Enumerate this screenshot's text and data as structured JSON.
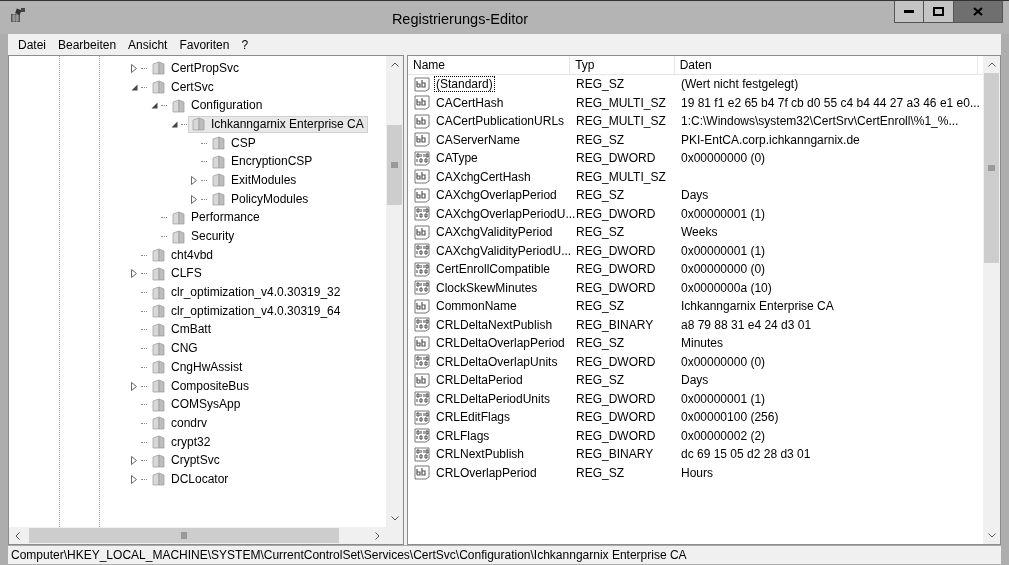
{
  "window": {
    "title": "Registrierungs-Editor"
  },
  "menu": [
    "Datei",
    "Bearbeiten",
    "Ansicht",
    "Favoriten",
    "?"
  ],
  "tree": [
    {
      "label": "CertPropSvc",
      "kind": "branch",
      "selected": false
    },
    {
      "label": "CertSvc",
      "kind": "branch",
      "selected": false,
      "children": [
        {
          "label": "Configuration",
          "kind": "branch",
          "selected": false,
          "children": [
            {
              "label": "Ichkanngarnix Enterprise CA",
              "kind": "branch",
              "selected": true,
              "children": [
                {
                  "label": "CSP",
                  "kind": "leaf",
                  "selected": false
                },
                {
                  "label": "EncryptionCSP",
                  "kind": "leaf",
                  "selected": false
                },
                {
                  "label": "ExitModules",
                  "kind": "branch",
                  "selected": false
                },
                {
                  "label": "PolicyModules",
                  "kind": "branch",
                  "selected": false
                }
              ]
            }
          ]
        },
        {
          "label": "Performance",
          "kind": "leaf",
          "selected": false
        },
        {
          "label": "Security",
          "kind": "leaf",
          "selected": false
        }
      ]
    },
    {
      "label": "cht4vbd",
      "kind": "leaf",
      "selected": false
    },
    {
      "label": "CLFS",
      "kind": "branch",
      "selected": false
    },
    {
      "label": "clr_optimization_v4.0.30319_32",
      "kind": "leaf",
      "selected": false
    },
    {
      "label": "clr_optimization_v4.0.30319_64",
      "kind": "leaf",
      "selected": false
    },
    {
      "label": "CmBatt",
      "kind": "leaf",
      "selected": false
    },
    {
      "label": "CNG",
      "kind": "leaf",
      "selected": false
    },
    {
      "label": "CngHwAssist",
      "kind": "leaf",
      "selected": false
    },
    {
      "label": "CompositeBus",
      "kind": "branch",
      "selected": false
    },
    {
      "label": "COMSysApp",
      "kind": "leaf",
      "selected": false
    },
    {
      "label": "condrv",
      "kind": "leaf",
      "selected": false
    },
    {
      "label": "crypt32",
      "kind": "leaf",
      "selected": false
    },
    {
      "label": "CryptSvc",
      "kind": "branch",
      "selected": false
    },
    {
      "label": "DCLocator",
      "kind": "branch",
      "selected": false
    }
  ],
  "values_table": {
    "columns": [
      "Name",
      "Typ",
      "Daten"
    ],
    "rows": [
      {
        "kind": "string",
        "name": "(Standard)",
        "type": "REG_SZ",
        "data": "(Wert nicht festgelegt)",
        "focused": true
      },
      {
        "kind": "string",
        "name": "CACertHash",
        "type": "REG_MULTI_SZ",
        "data": "19 81 f1 e2 65 b4 7f cb d0 55 c4 b4 44 27 a3 46 e1 e0...",
        "focused": false
      },
      {
        "kind": "string",
        "name": "CACertPublicationURLs",
        "type": "REG_MULTI_SZ",
        "data": "1:C:\\Windows\\system32\\CertSrv\\CertEnroll\\%1_%...",
        "focused": false
      },
      {
        "kind": "string",
        "name": "CAServerName",
        "type": "REG_SZ",
        "data": "PKI-EntCA.corp.ichkanngarnix.de",
        "focused": false
      },
      {
        "kind": "binary",
        "name": "CAType",
        "type": "REG_DWORD",
        "data": "0x00000000 (0)",
        "focused": false
      },
      {
        "kind": "string",
        "name": "CAXchgCertHash",
        "type": "REG_MULTI_SZ",
        "focused": false
      },
      {
        "kind": "string",
        "name": "CAXchgOverlapPeriod",
        "type": "REG_SZ",
        "data": "Days",
        "focused": false
      },
      {
        "kind": "binary",
        "name": "CAXchgOverlapPeriodU...",
        "type": "REG_DWORD",
        "data": "0x00000001 (1)",
        "focused": false
      },
      {
        "kind": "string",
        "name": "CAXchgValidityPeriod",
        "type": "REG_SZ",
        "data": "Weeks",
        "focused": false
      },
      {
        "kind": "binary",
        "name": "CAXchgValidityPeriodU...",
        "type": "REG_DWORD",
        "data": "0x00000001 (1)",
        "focused": false
      },
      {
        "kind": "binary",
        "name": "CertEnrollCompatible",
        "type": "REG_DWORD",
        "data": "0x00000000 (0)",
        "focused": false
      },
      {
        "kind": "binary",
        "name": "ClockSkewMinutes",
        "type": "REG_DWORD",
        "data": "0x0000000a (10)",
        "focused": false
      },
      {
        "kind": "string",
        "name": "CommonName",
        "type": "REG_SZ",
        "data": "Ichkanngarnix Enterprise CA",
        "focused": false
      },
      {
        "kind": "binary",
        "name": "CRLDeltaNextPublish",
        "type": "REG_BINARY",
        "data": "a8 79 88 31 e4 24 d3 01",
        "focused": false
      },
      {
        "kind": "string",
        "name": "CRLDeltaOverlapPeriod",
        "type": "REG_SZ",
        "data": "Minutes",
        "focused": false
      },
      {
        "kind": "binary",
        "name": "CRLDeltaOverlapUnits",
        "type": "REG_DWORD",
        "data": "0x00000000 (0)",
        "focused": false
      },
      {
        "kind": "string",
        "name": "CRLDeltaPeriod",
        "type": "REG_SZ",
        "data": "Days",
        "focused": false
      },
      {
        "kind": "binary",
        "name": "CRLDeltaPeriodUnits",
        "type": "REG_DWORD",
        "data": "0x00000001 (1)",
        "focused": false
      },
      {
        "kind": "binary",
        "name": "CRLEditFlags",
        "type": "REG_DWORD",
        "data": "0x00000100 (256)",
        "focused": false
      },
      {
        "kind": "binary",
        "name": "CRLFlags",
        "type": "REG_DWORD",
        "data": "0x00000002 (2)",
        "focused": false
      },
      {
        "kind": "binary",
        "name": "CRLNextPublish",
        "type": "REG_BINARY",
        "data": "dc 69 15 05 d2 28 d3 01",
        "focused": false
      },
      {
        "kind": "string",
        "name": "CRLOverlapPeriod",
        "type": "REG_SZ",
        "data": "Hours",
        "focused": false
      }
    ]
  },
  "status_bar": "Computer\\HKEY_LOCAL_MACHINE\\SYSTEM\\CurrentControlSet\\Services\\CertSvc\\Configuration\\Ichkanngarnix Enterprise CA"
}
